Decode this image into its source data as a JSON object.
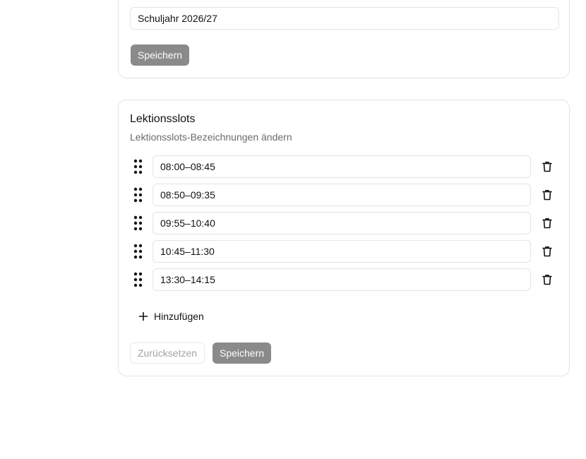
{
  "school_year_card": {
    "school_year_value": "Schuljahr 2026/27",
    "save_label": "Speichern"
  },
  "slots_card": {
    "title": "Lektionsslots",
    "description": "Lektionsslots-Bezeichnungen ändern",
    "slots": [
      {
        "label": "08:00–08:45"
      },
      {
        "label": "08:50–09:35"
      },
      {
        "label": "09:55–10:40"
      },
      {
        "label": "10:45–11:30"
      },
      {
        "label": "13:30–14:15"
      }
    ],
    "add_label": "Hinzufügen",
    "reset_label": "Zurücksetzen",
    "save_label": "Speichern"
  },
  "icons": {
    "drag": "drag-handle-icon",
    "delete": "trash-icon",
    "add": "plus-icon"
  },
  "colors": {
    "primary_button": "#8a8a8a",
    "border": "#e4e4e7",
    "muted_text": "#6b6b6b"
  }
}
